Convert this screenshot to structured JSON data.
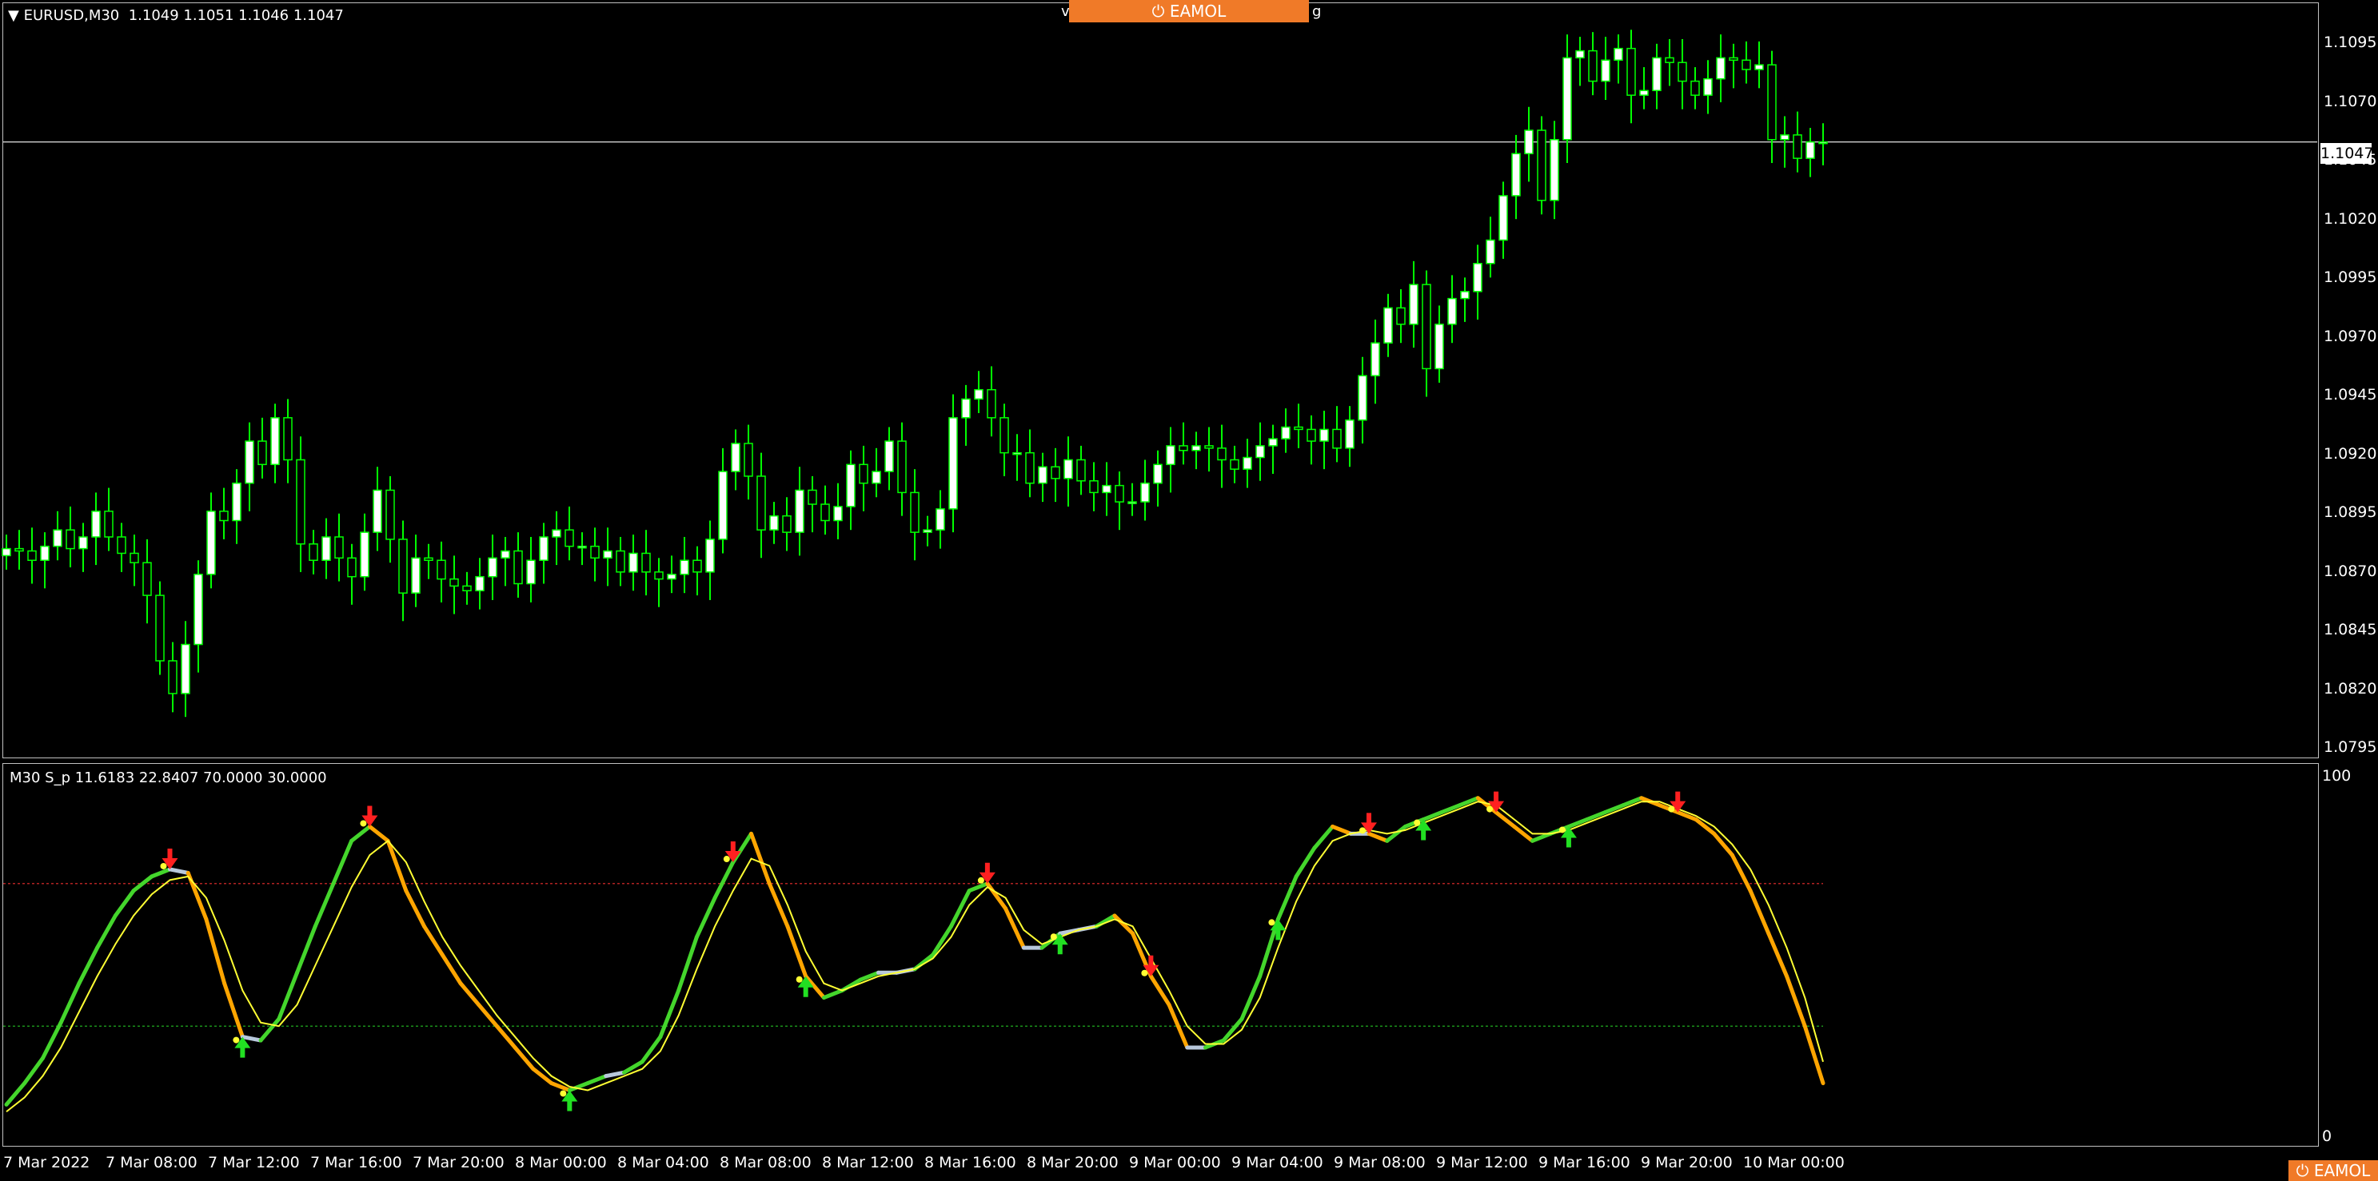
{
  "chart_header": {
    "collapse_glyph": "▼",
    "symbol": "EURUSD,M30",
    "ohlc": "1.1049 1.1051 1.1046 1.1047"
  },
  "banner": {
    "logo_text": "EAMOL",
    "left_fragment": "v",
    "right_fragment": "g"
  },
  "corner_brand": {
    "logo_text": "EAMOL"
  },
  "price_axis": [
    "1.1095",
    "1.1070",
    "1.1045",
    "1.1020",
    "1.0995",
    "1.0970",
    "1.0945",
    "1.0920",
    "1.0895",
    "1.0870",
    "1.0845",
    "1.0820",
    "1.0795"
  ],
  "current_price": "1.1047",
  "indicator": {
    "label": "M30 S_p 11.6183 22.8407 70.0000 30.0000",
    "axis_max": "100",
    "axis_min": "0",
    "upper_level": 70,
    "lower_level": 30
  },
  "time_axis": [
    "7 Mar 2022",
    "7 Mar 08:00",
    "7 Mar 12:00",
    "7 Mar 16:00",
    "7 Mar 20:00",
    "8 Mar 00:00",
    "8 Mar 04:00",
    "8 Mar 08:00",
    "8 Mar 12:00",
    "8 Mar 16:00",
    "8 Mar 20:00",
    "9 Mar 00:00",
    "9 Mar 04:00",
    "9 Mar 08:00",
    "9 Mar 12:00",
    "9 Mar 16:00",
    "9 Mar 20:00",
    "10 Mar 00:00"
  ],
  "colors": {
    "bull": "#ffffff",
    "bear": "#000000",
    "wick": "#00ff00",
    "upper_level": "#b22222",
    "lower_level": "#1a8f1a",
    "accent": "#f07a28"
  },
  "chart_data": [
    {
      "type": "candlestick",
      "title": "EURUSD,M30",
      "ylim": [
        1.0785,
        1.1105
      ],
      "x_labels": [
        "7 Mar 2022",
        "7 Mar 08:00",
        "7 Mar 12:00",
        "7 Mar 16:00",
        "7 Mar 20:00",
        "8 Mar 00:00",
        "8 Mar 04:00",
        "8 Mar 08:00",
        "8 Mar 12:00",
        "8 Mar 16:00",
        "8 Mar 20:00",
        "9 Mar 00:00",
        "9 Mar 04:00",
        "9 Mar 08:00",
        "9 Mar 12:00",
        "9 Mar 16:00",
        "9 Mar 20:00",
        "10 Mar 00:00"
      ],
      "close": [
        1.0873,
        1.0872,
        1.0868,
        1.0874,
        1.0881,
        1.0873,
        1.0878,
        1.0889,
        1.0878,
        1.0871,
        1.0867,
        1.0853,
        1.0825,
        1.0811,
        1.0832,
        1.0862,
        1.0889,
        1.0885,
        1.0901,
        1.0919,
        1.0909,
        1.0929,
        1.0911,
        1.0875,
        1.0868,
        1.0878,
        1.0869,
        1.0861,
        1.088,
        1.0898,
        1.0877,
        1.0854,
        1.0869,
        1.0868,
        1.086,
        1.0857,
        1.0855,
        1.0861,
        1.0869,
        1.0872,
        1.0858,
        1.0868,
        1.0878,
        1.0881,
        1.0874,
        1.0874,
        1.0869,
        1.0872,
        1.0863,
        1.0871,
        1.0863,
        1.086,
        1.0862,
        1.0868,
        1.0863,
        1.0877,
        1.0906,
        1.0918,
        1.0904,
        1.0881,
        1.0887,
        1.088,
        1.0898,
        1.0892,
        1.0885,
        1.0891,
        1.0909,
        1.0901,
        1.0906,
        1.0919,
        1.0897,
        1.088,
        1.0881,
        1.089,
        1.0929,
        1.0937,
        1.0941,
        1.0929,
        1.0914,
        1.0914,
        1.0901,
        1.0908,
        1.0903,
        1.0911,
        1.0902,
        1.0897,
        1.09,
        1.0893,
        1.0893,
        1.0901,
        1.0909,
        1.0917,
        1.0915,
        1.0917,
        1.0916,
        1.0911,
        1.0907,
        1.0912,
        1.0917,
        1.092,
        1.0925,
        1.0924,
        1.0919,
        1.0924,
        1.0916,
        1.0928,
        1.0947,
        1.0961,
        1.0976,
        1.0969,
        1.0986,
        1.095,
        1.0969,
        1.098,
        1.0983,
        1.0995,
        1.1005,
        1.1024,
        1.1042,
        1.1052,
        1.1022,
        1.1048,
        1.1083,
        1.1086,
        1.1073,
        1.1082,
        1.1087,
        1.1067,
        1.1069,
        1.1083,
        1.1081,
        1.1073,
        1.1067,
        1.1074,
        1.1083,
        1.1082,
        1.1078,
        1.108,
        1.1048,
        1.105,
        1.104,
        1.1047,
        1.1047
      ]
    },
    {
      "type": "line",
      "title": "M30 S_p 11.6183 22.8407 70.0000 30.0000",
      "ylim": [
        0,
        100
      ],
      "levels": [
        70,
        30
      ],
      "series": [
        {
          "values": [
            8,
            14,
            21,
            31,
            42,
            52,
            61,
            68,
            72,
            74,
            73,
            60,
            42,
            27,
            26,
            32,
            45,
            58,
            70,
            82,
            86,
            82,
            68,
            58,
            50,
            42,
            36,
            30,
            24,
            18,
            14,
            12,
            14,
            16,
            17,
            20,
            27,
            40,
            55,
            66,
            76,
            84,
            70,
            58,
            44,
            38,
            40,
            43,
            45,
            45,
            46,
            50,
            58,
            68,
            70,
            63,
            52,
            52,
            56,
            57,
            58,
            61,
            56,
            44,
            36,
            24,
            24,
            26,
            32,
            44,
            60,
            72,
            80,
            86,
            84,
            84,
            82,
            86,
            88,
            90,
            92,
            94,
            90,
            86,
            82,
            84,
            86,
            88,
            90,
            92,
            94,
            92,
            90,
            88,
            84,
            78,
            68,
            56,
            44,
            30,
            14
          ]
        },
        {
          "values": [
            6,
            10,
            16,
            24,
            34,
            44,
            53,
            61,
            67,
            71,
            72,
            66,
            54,
            40,
            31,
            30,
            36,
            47,
            58,
            69,
            78,
            82,
            76,
            65,
            55,
            47,
            40,
            33,
            27,
            21,
            16,
            13,
            12,
            14,
            16,
            18,
            23,
            33,
            46,
            58,
            68,
            77,
            75,
            64,
            51,
            42,
            40,
            42,
            44,
            45,
            46,
            49,
            55,
            64,
            69,
            66,
            57,
            53,
            55,
            57,
            58,
            60,
            58,
            49,
            40,
            30,
            25,
            25,
            29,
            38,
            52,
            65,
            75,
            82,
            84,
            85,
            84,
            85,
            87,
            89,
            91,
            93,
            92,
            88,
            84,
            84,
            85,
            87,
            89,
            91,
            93,
            93,
            91,
            89,
            86,
            81,
            74,
            64,
            52,
            38,
            20
          ]
        }
      ],
      "markers": [
        {
          "index": 9,
          "type": "sell"
        },
        {
          "index": 13,
          "type": "buy"
        },
        {
          "index": 20,
          "type": "sell"
        },
        {
          "index": 31,
          "type": "buy"
        },
        {
          "index": 40,
          "type": "sell"
        },
        {
          "index": 44,
          "type": "buy"
        },
        {
          "index": 54,
          "type": "sell"
        },
        {
          "index": 58,
          "type": "buy"
        },
        {
          "index": 63,
          "type": "sell"
        },
        {
          "index": 70,
          "type": "buy"
        },
        {
          "index": 75,
          "type": "sell"
        },
        {
          "index": 78,
          "type": "buy"
        },
        {
          "index": 82,
          "type": "sell"
        },
        {
          "index": 86,
          "type": "buy"
        },
        {
          "index": 92,
          "type": "sell"
        }
      ]
    }
  ]
}
